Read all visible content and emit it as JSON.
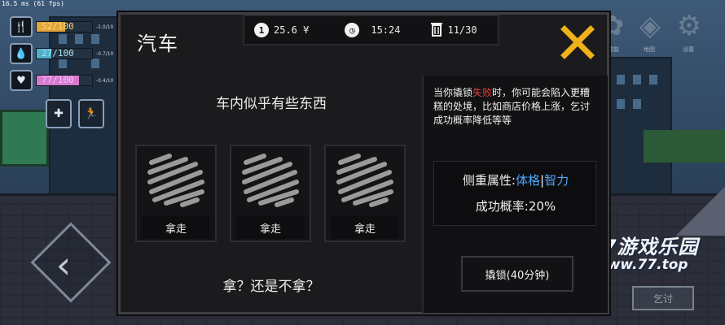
{
  "fps_text": "16.5 ms (61 fps)",
  "stats": [
    {
      "value": "52/100",
      "delta": "-1.0/10",
      "fill": 0.52,
      "color": "#e0a63a",
      "icon": "fork-knife-icon"
    },
    {
      "value": "27/100",
      "delta": "-0.7/10",
      "fill": 0.27,
      "color": "#4fb0c8",
      "icon": "water-drop-icon"
    },
    {
      "value": "77/100",
      "delta": "-0.4/10",
      "fill": 0.77,
      "color": "#d57ad0",
      "icon": "heartbeat-icon"
    }
  ],
  "hud_buttons": [
    {
      "icon": "heal-icon"
    },
    {
      "icon": "run-icon"
    }
  ],
  "top_menu": [
    {
      "icon": "skill-icon",
      "label": "技能"
    },
    {
      "icon": "map-icon",
      "label": "地图"
    },
    {
      "icon": "gear-icon",
      "label": "设置"
    }
  ],
  "beg_button_label": "乞讨",
  "watermark": {
    "logo": "77游戏乐园",
    "url": "www.77.top"
  },
  "dialog": {
    "title": "汽车",
    "money": "25.6 ¥",
    "money_icon_glyph": "1",
    "time": "15:24",
    "trash": "11/30",
    "prompt": "车内似乎有些东西",
    "slots": [
      {
        "label": "拿走"
      },
      {
        "label": "拿走"
      },
      {
        "label": "拿走"
      }
    ],
    "question": "拿？还是不拿？",
    "warning_pre": "当你撬锁",
    "warning_em": "失败",
    "warning_post": "时，你可能会陷入更糟糕的处境，比如商店价格上涨，乞讨成功概率降低等等",
    "attr_label": "侧重属性:",
    "attr_a": "体格",
    "attr_sep": "|",
    "attr_b": "智力",
    "success_rate": "成功概率:20%",
    "pick_button": "撬锁(40分钟)"
  },
  "colors": {
    "accent": "#f0b21a",
    "danger": "#e53a3a",
    "attr": "#4fa8ff",
    "dialog_bg": "#1b1b1d"
  }
}
